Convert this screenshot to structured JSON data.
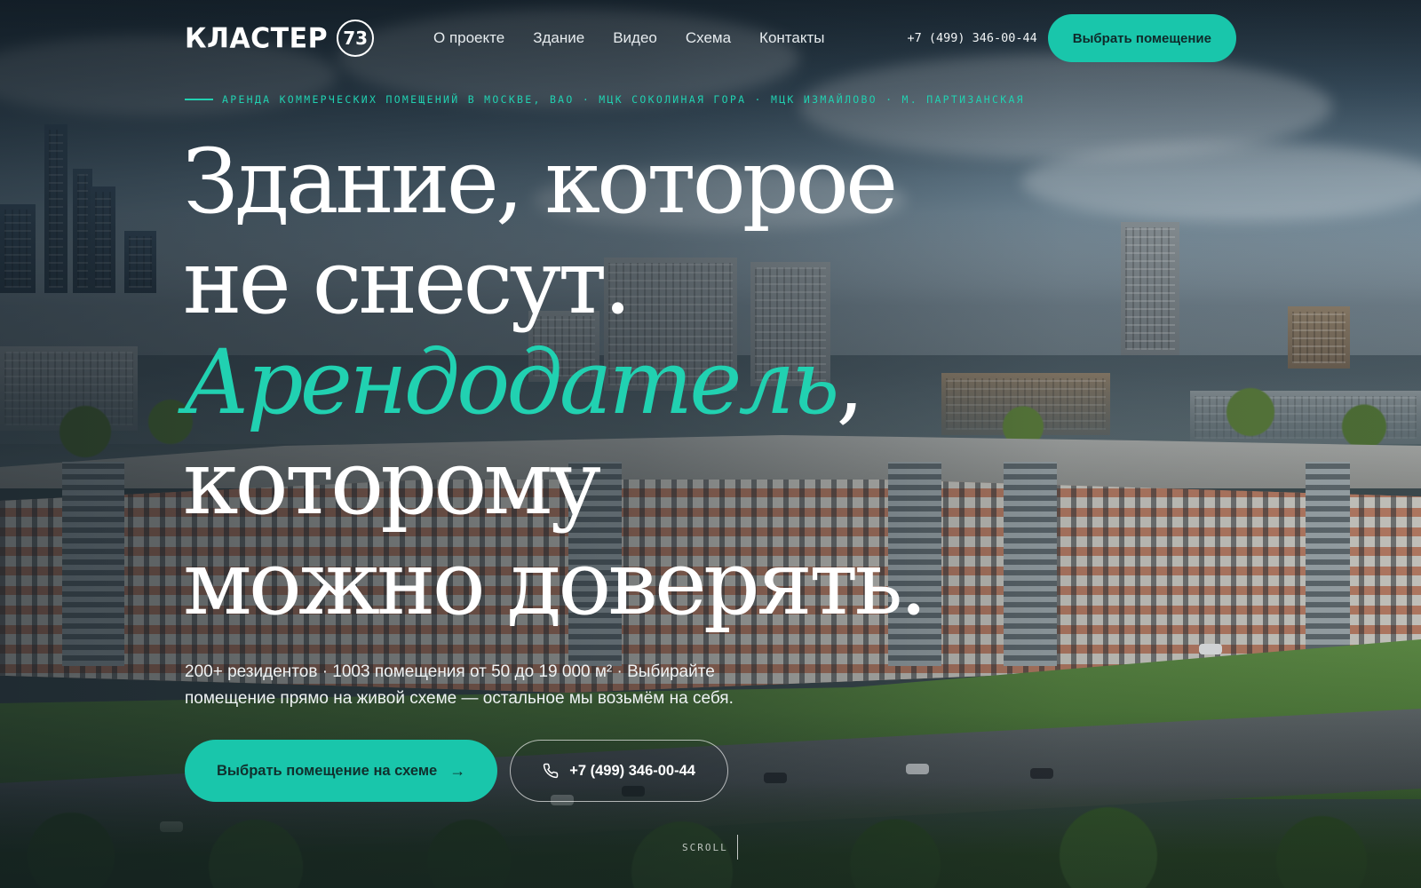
{
  "brand": {
    "name": "КЛАСТЕР",
    "number": "73"
  },
  "nav": {
    "items": [
      {
        "label": "О проекте"
      },
      {
        "label": "Здание"
      },
      {
        "label": "Видео"
      },
      {
        "label": "Схема"
      },
      {
        "label": "Контакты"
      }
    ]
  },
  "header": {
    "phone": "+7 (499) 346-00-44",
    "cta_label": "Выбрать помещение"
  },
  "hero": {
    "eyebrow": "АРЕНДА КОММЕРЧЕСКИХ ПОМЕЩЕНИЙ В МОСКВЕ, ВАО · МЦК СОКОЛИНАЯ ГОРА · МЦК ИЗМАЙЛОВО · М. ПАРТИЗАНСКАЯ",
    "headline": {
      "line1": "Здание, которое",
      "line2": "не снесут.",
      "accent": "Арендодатель",
      "accent_suffix": ",",
      "line4": "которому",
      "line5": "можно доверять."
    },
    "subtitle": "200+ резидентов · 1003 помещения от 50 до 19 000 м² · Выбирайте помещение прямо на живой схеме — остальное мы возьмём на себя.",
    "cta_primary_label": "Выбрать помещение на схеме",
    "cta_primary_icon": "arrow-right-icon",
    "cta_secondary_label": "+7 (499) 346-00-44",
    "cta_secondary_icon": "phone-icon",
    "scroll_label": "SCROLL"
  },
  "colors": {
    "accent": "#19c6ab",
    "accent_text": "#21d1b1",
    "text": "#ffffff"
  }
}
